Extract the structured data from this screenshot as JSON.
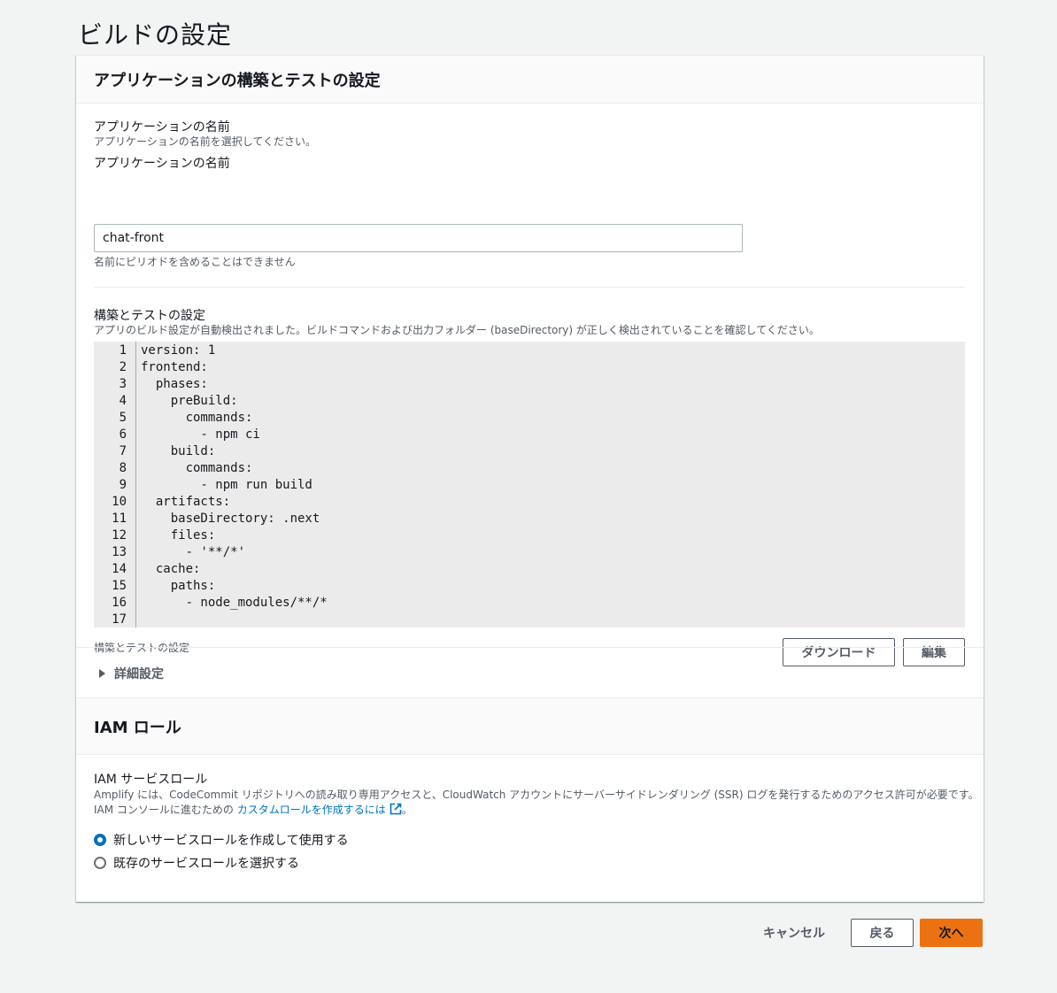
{
  "page_title": "ビルドの設定",
  "app_section": {
    "header": "アプリケーションの構築とテストの設定",
    "app_name_label": "アプリケーションの名前",
    "app_name_description": "アプリケーションの名前を選択してください。",
    "app_name_field_label": "アプリケーションの名前",
    "app_name_value": "chat-front",
    "app_name_constraint": "名前にピリオドを含めることはできません",
    "build_settings_label": "構築とテストの設定",
    "build_settings_description": "アプリのビルド設定が自動検出されました。ビルドコマンドおよび出力フォルダー (baseDirectory) が正しく検出されていることを確認してください。",
    "code": {
      "line_numbers": [
        "1",
        "2",
        "3",
        "4",
        "5",
        "6",
        "7",
        "8",
        "9",
        "10",
        "11",
        "12",
        "13",
        "14",
        "15",
        "16",
        "17"
      ],
      "lines": [
        "version: 1",
        "frontend:",
        "  phases:",
        "    preBuild:",
        "      commands:",
        "        - npm ci",
        "    build:",
        "      commands:",
        "        - npm run build",
        "  artifacts:",
        "    baseDirectory: .next",
        "    files:",
        "      - '**/*'",
        "  cache:",
        "    paths:",
        "      - node_modules/**/*",
        ""
      ]
    },
    "editor_caption": "構築とテストの設定",
    "download_button": "ダウンロード",
    "edit_button": "編集",
    "advanced_settings": "詳細設定"
  },
  "iam_section": {
    "header": "IAM ロール",
    "service_role_label": "IAM サービスロール",
    "description_line1": "Amplify には、CodeCommit リポジトリへの読み取り専用アクセスと、CloudWatch アカウントにサーバーサイドレンダリング (SSR) ログを発行するためのアクセス許可が必要です。",
    "description_line2_prefix": "IAM コンソールに進むための ",
    "description_link": "カスタムロールを作成するには",
    "description_line2_suffix": "。",
    "options": [
      {
        "label": "新しいサービスロールを作成して使用する",
        "checked": true
      },
      {
        "label": "既存のサービスロールを選択する",
        "checked": false
      }
    ]
  },
  "footer": {
    "cancel": "キャンセル",
    "back": "戻る",
    "next": "次へ"
  },
  "colors": {
    "primary": "#ec7211",
    "link": "#0073bb",
    "background": "#f2f3f3"
  }
}
